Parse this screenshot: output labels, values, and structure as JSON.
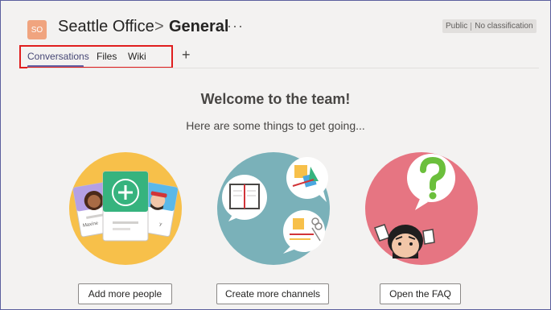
{
  "header": {
    "team_initials": "SO",
    "team_name": "Seattle Office",
    "separator": ">",
    "channel_name": "General",
    "more": "···",
    "badge_visibility": "Public",
    "badge_classification": "No classification"
  },
  "tabs": [
    {
      "label": "Conversations",
      "active": true
    },
    {
      "label": "Files",
      "active": false
    },
    {
      "label": "Wiki",
      "active": false
    }
  ],
  "add_tab": "+",
  "main": {
    "welcome_title": "Welcome to the team!",
    "welcome_subtitle": "Here are some things to get going...",
    "actions": [
      {
        "label": "Add more people",
        "icon": "people-cards-illustration"
      },
      {
        "label": "Create more channels",
        "icon": "notebook-channels-illustration"
      },
      {
        "label": "Open the FAQ",
        "icon": "faq-question-illustration"
      }
    ],
    "card_labels": [
      "Maxine",
      "y"
    ]
  },
  "colors": {
    "accent": "#6264a7",
    "highlight_box": "#e01e1e",
    "people_circle": "#f7c04a",
    "channels_circle": "#7ab1b9",
    "faq_circle": "#e67582",
    "team_avatar": "#f0a47f"
  }
}
